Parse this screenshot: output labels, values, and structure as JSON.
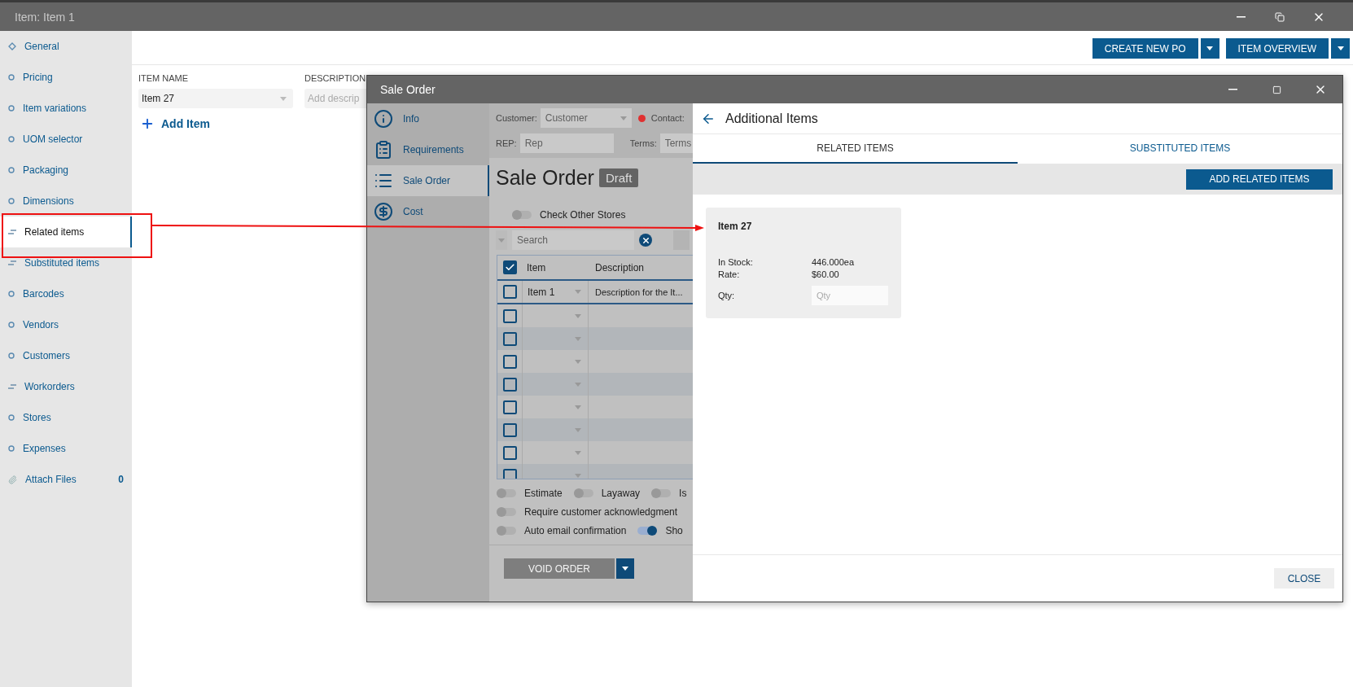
{
  "window": {
    "title": "Item: Item 1"
  },
  "sidebar": {
    "items": [
      {
        "label": "General",
        "kind": "diamond",
        "selected": false
      },
      {
        "label": "Pricing",
        "kind": "circle",
        "selected": false
      },
      {
        "label": "Item variations",
        "kind": "circle",
        "selected": false
      },
      {
        "label": "UOM selector",
        "kind": "circle",
        "selected": false
      },
      {
        "label": "Packaging",
        "kind": "circle",
        "selected": false
      },
      {
        "label": "Dimensions",
        "kind": "circle",
        "selected": false
      },
      {
        "label": "Related items",
        "kind": "lines",
        "selected": true
      },
      {
        "label": "Substituted items",
        "kind": "lines",
        "selected": false
      },
      {
        "label": "Barcodes",
        "kind": "circle",
        "selected": false
      },
      {
        "label": "Vendors",
        "kind": "circle",
        "selected": false
      },
      {
        "label": "Customers",
        "kind": "circle",
        "selected": false
      },
      {
        "label": "Workorders",
        "kind": "lines",
        "selected": false
      },
      {
        "label": "Stores",
        "kind": "circle",
        "selected": false
      },
      {
        "label": "Expenses",
        "kind": "circle",
        "selected": false
      },
      {
        "label": "Attach Files",
        "kind": "clip",
        "selected": false,
        "count": "0"
      }
    ]
  },
  "toolbar": {
    "buttons": [
      {
        "label": "CREATE NEW PO"
      },
      {
        "label": "ITEM OVERVIEW"
      }
    ]
  },
  "form": {
    "fields": [
      {
        "label": "ITEM NAME",
        "value": "Item 27",
        "kind": "dropdown"
      },
      {
        "label": "DESCRIPTION",
        "placeholder": "Add descrip",
        "kind": "text"
      }
    ],
    "add_item": "Add Item"
  },
  "dialog": {
    "title": "Sale Order",
    "nav": [
      {
        "label": "Info",
        "kind": "info",
        "selected": false
      },
      {
        "label": "Requirements",
        "kind": "clipboard",
        "selected": false
      },
      {
        "label": "Sale Order",
        "kind": "list",
        "selected": true
      },
      {
        "label": "Cost",
        "kind": "dollar",
        "selected": false
      }
    ],
    "order": {
      "customer_label": "Customer:",
      "customer_placeholder": "Customer",
      "contact_label": "Contact:",
      "rep_label": "REP:",
      "rep_placeholder": "Rep",
      "terms_label": "Terms:",
      "terms_placeholder": "Terms",
      "heading": "Sale Order",
      "status": "Draft",
      "check_other_stores": {
        "label": "Check Other Stores",
        "on": false
      },
      "search_placeholder": "Search",
      "table": {
        "all_checked": true,
        "columns": [
          "Item",
          "Description"
        ],
        "rows": [
          {
            "item": "Item 1",
            "description": "Description for the It...",
            "checked": false
          },
          {
            "checked": false
          },
          {
            "checked": false
          },
          {
            "checked": false
          },
          {
            "checked": false
          },
          {
            "checked": false
          },
          {
            "checked": false
          },
          {
            "checked": false
          },
          {
            "checked": false
          }
        ]
      },
      "toggles": [
        [
          {
            "label": "Estimate",
            "on": false
          },
          {
            "label": "Layaway",
            "on": false
          },
          {
            "label": "Is",
            "on": false
          }
        ],
        [
          {
            "label": "Require customer acknowledgment",
            "on": false
          }
        ],
        [
          {
            "label": "Auto email confirmation",
            "on": false
          },
          {
            "label": "Sho",
            "on": true
          }
        ]
      ],
      "void_button": {
        "label": "VOID ORDER",
        "disabled": true
      }
    },
    "additional": {
      "title": "Additional Items",
      "tabs": [
        {
          "label": "RELATED ITEMS",
          "selected": true
        },
        {
          "label": "SUBSTITUTED ITEMS",
          "selected": false
        }
      ],
      "add_button": "ADD RELATED ITEMS",
      "cards": [
        {
          "name": "Item 27",
          "stock_label": "In Stock:",
          "stock": "446.000ea",
          "rate_label": "Rate:",
          "rate": "$60.00",
          "qty_label": "Qty:",
          "qty_placeholder": "Qty"
        }
      ],
      "close_button": "CLOSE"
    }
  }
}
